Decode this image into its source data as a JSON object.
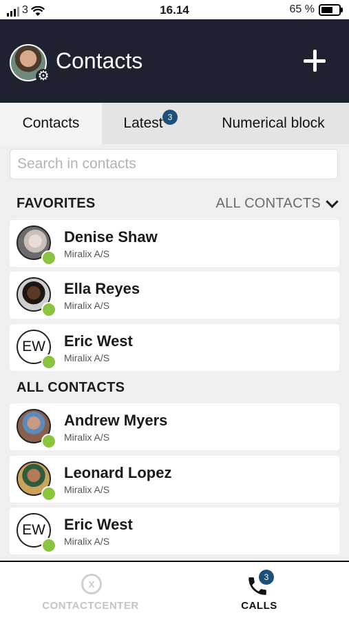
{
  "status_bar": {
    "carrier": "3",
    "time": "16.14",
    "battery": "65 %",
    "battery_level": 0.65
  },
  "header": {
    "title": "Contacts",
    "profile_icon": "gear-icon",
    "add_icon": "plus-icon"
  },
  "tabs": [
    {
      "label": "Contacts",
      "active": true
    },
    {
      "label": "Latest",
      "badge": "3",
      "active": false
    },
    {
      "label": "Numerical block",
      "active": false
    }
  ],
  "search": {
    "placeholder": "Search in contacts",
    "value": ""
  },
  "favorites": {
    "heading": "FAVORITES",
    "filter_label": "ALL CONTACTS",
    "items": [
      {
        "name": "Denise Shaw",
        "company": "Miralix A/S",
        "presence": "available"
      },
      {
        "name": "Ella Reyes",
        "company": "Miralix A/S",
        "presence": "available"
      },
      {
        "name": "Eric West",
        "company": "Miralix A/S",
        "initials": "EW",
        "presence": "available"
      }
    ]
  },
  "all_contacts": {
    "heading": "ALL CONTACTS",
    "items": [
      {
        "name": "Andrew Myers",
        "company": "Miralix A/S",
        "presence": "available"
      },
      {
        "name": "Leonard Lopez",
        "company": "Miralix A/S",
        "presence": "available"
      },
      {
        "name": "Eric West",
        "company": "Miralix A/S",
        "initials": "EW",
        "presence": "available"
      }
    ]
  },
  "bottom_nav": [
    {
      "label": "CONTACTCENTER",
      "icon": "contactcenter-icon",
      "active": false
    },
    {
      "label": "CALLS",
      "icon": "phone-icon",
      "badge": "3",
      "active": true
    }
  ],
  "colors": {
    "header_bg": "#1e2230",
    "presence_available": "#8bc53f",
    "badge_bg": "#1d4f7a"
  }
}
